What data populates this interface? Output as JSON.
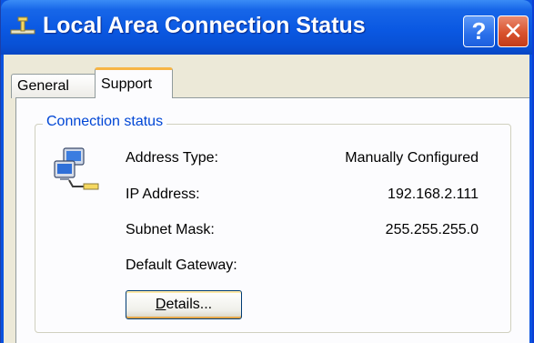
{
  "window": {
    "title": "Local Area Connection Status",
    "help_glyph": "?",
    "close_glyph": "✕"
  },
  "tabs": [
    {
      "label": "General",
      "active": false
    },
    {
      "label": "Support",
      "active": true
    }
  ],
  "connection_status": {
    "group_label": "Connection status",
    "rows": [
      {
        "label": "Address Type:",
        "value": "Manually Configured"
      },
      {
        "label": "IP Address:",
        "value": "192.168.2.111"
      },
      {
        "label": "Subnet Mask:",
        "value": "255.255.255.0"
      },
      {
        "label": "Default Gateway:",
        "value": ""
      }
    ],
    "details_button": {
      "mnemonic": "D",
      "rest": "etails..."
    }
  },
  "icons": {
    "app": "network-connection-icon",
    "status": "network-computers-icon"
  },
  "colors": {
    "titlebar": "#0a58e2",
    "dialog_bg": "#ece9d8",
    "group_label": "#0046d5",
    "close_button": "#d9532e",
    "active_tab_accent": "#f7b545"
  }
}
